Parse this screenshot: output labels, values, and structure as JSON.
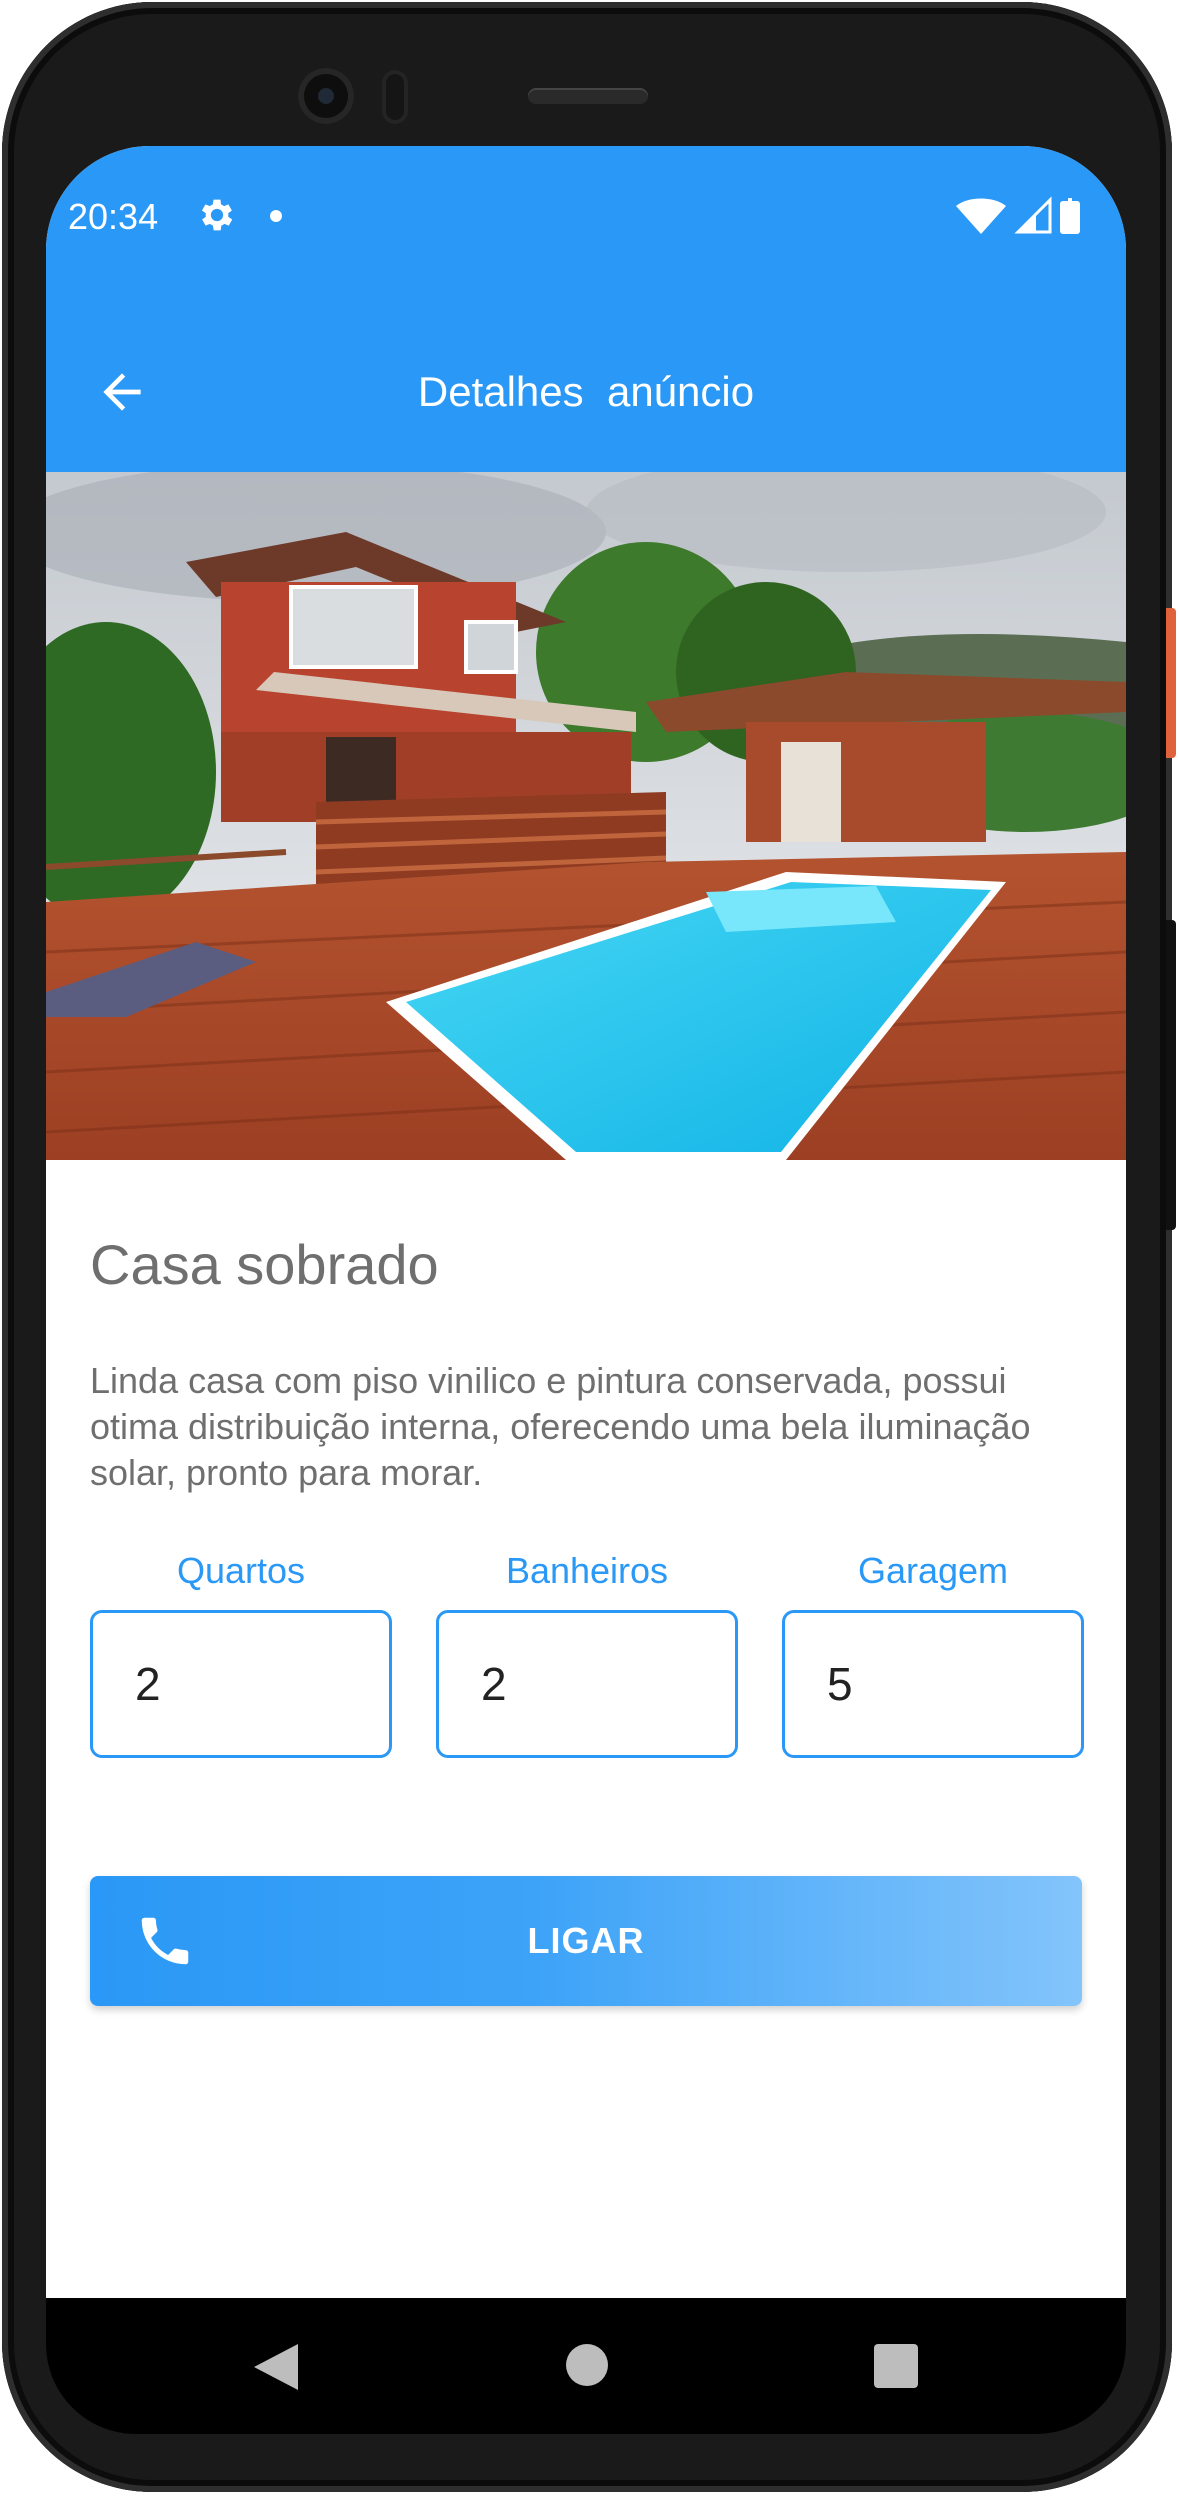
{
  "status_bar": {
    "time": "20:34",
    "icons": [
      "gear-icon",
      "notification-dot-icon",
      "wifi-icon",
      "signal-icon",
      "battery-icon"
    ]
  },
  "app_bar": {
    "title": "Detalhes  anúncio",
    "back_icon": "arrow-back-icon"
  },
  "listing": {
    "title": "Casa sobrado",
    "description": "Linda casa com piso vinilico e pintura conservada, possui otima distribuição interna, oferecendo uma bela iluminação solar, pronto para morar.",
    "fields": [
      {
        "label": "Quartos",
        "value": "2"
      },
      {
        "label": "Banheiros",
        "value": "2"
      },
      {
        "label": "Garagem",
        "value": "5"
      }
    ]
  },
  "call_button": {
    "label": "LIGAR",
    "icon": "phone-icon"
  },
  "navigation": {
    "icons": [
      "nav-back-icon",
      "nav-home-icon",
      "nav-recents-icon"
    ]
  },
  "colors": {
    "primary": "#2a98f6",
    "text_gray": "#6f6f6f"
  }
}
